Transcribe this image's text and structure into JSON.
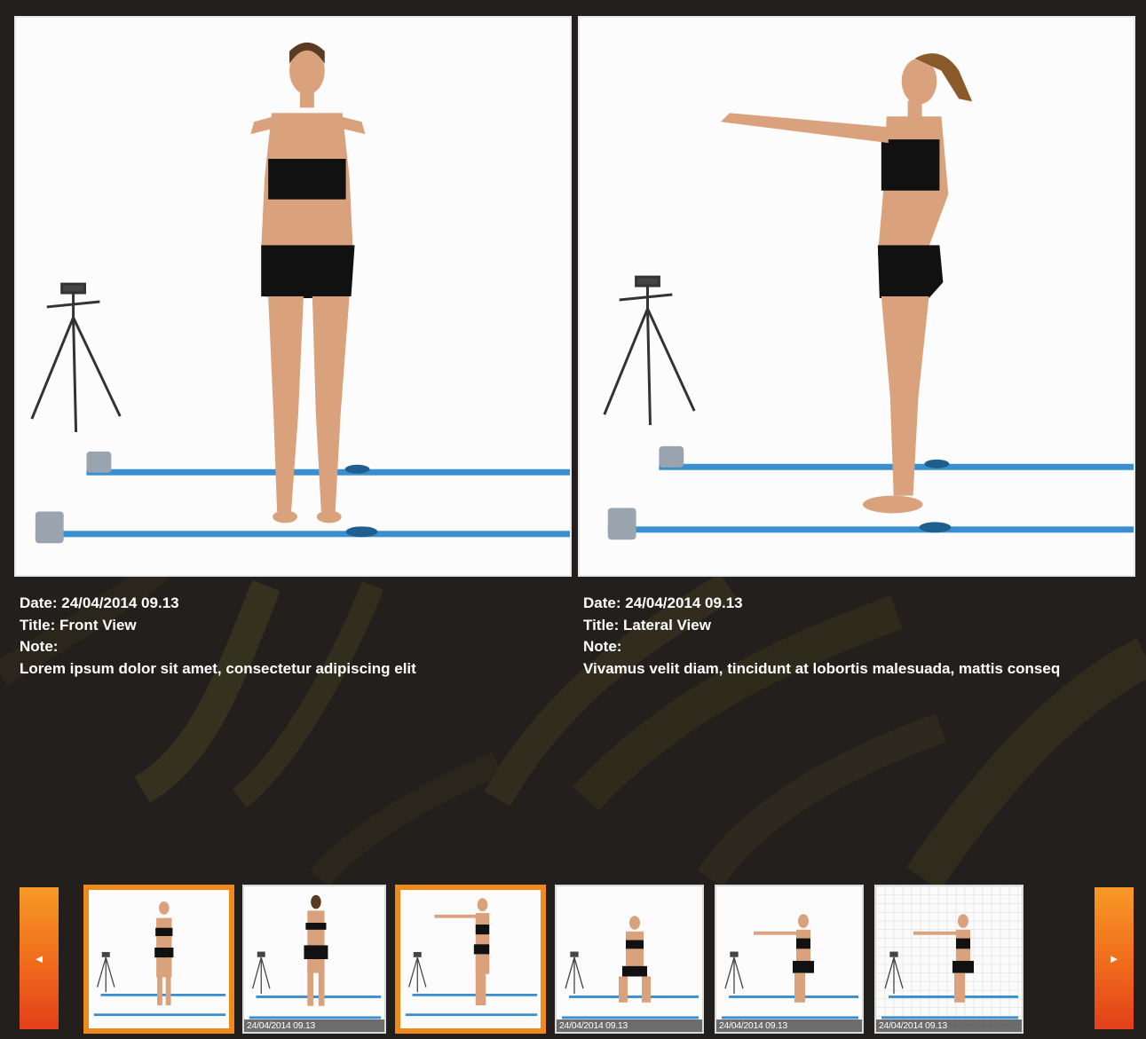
{
  "viewer": {
    "left": {
      "date_label": "Date:",
      "date": "24/04/2014 09.13",
      "title_label": "Title:",
      "title": "Front View",
      "note_label": "Note:",
      "note": "Lorem ipsum dolor sit amet, consectetur adipiscing elit"
    },
    "right": {
      "date_label": "Date:",
      "date": "24/04/2014 09.13",
      "title_label": "Title:",
      "title": "Lateral View",
      "note_label": "Note:",
      "note": "Vivamus velit diam, tincidunt at lobortis malesuada, mattis conseq"
    }
  },
  "carousel": {
    "prev_icon": "triangle-left-icon",
    "prev_glyph": "◄",
    "next_icon": "triangle-right-icon",
    "next_glyph": "►",
    "thumbnails": [
      {
        "pose": "front",
        "date": "",
        "selected": true
      },
      {
        "pose": "back",
        "date": "24/04/2014 09.13",
        "selected": false
      },
      {
        "pose": "lateral",
        "date": "",
        "selected": true
      },
      {
        "pose": "squat-front",
        "date": "24/04/2014 09.13",
        "selected": false
      },
      {
        "pose": "squat-side",
        "date": "24/04/2014 09.13",
        "selected": false
      },
      {
        "pose": "squat-side-grid",
        "date": "24/04/2014 09.13",
        "selected": false
      }
    ]
  },
  "colors": {
    "background": "#231f1c",
    "accent_orange": "#f0891c",
    "track_blue": "#3a8fd0"
  }
}
